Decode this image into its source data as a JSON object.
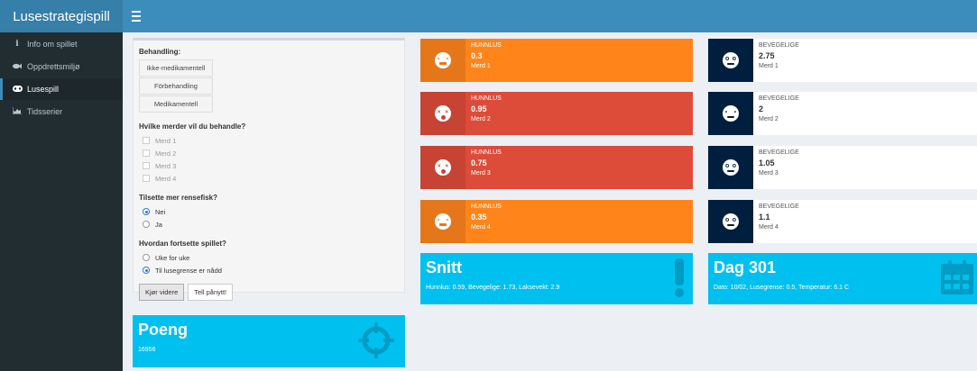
{
  "app": {
    "title": "Lusestrategispill"
  },
  "sidebar": {
    "items": [
      {
        "label": "Info om spillet",
        "icon": "info-icon",
        "active": false
      },
      {
        "label": "Oppdrettsmiljø",
        "icon": "fish-icon",
        "active": false
      },
      {
        "label": "Lusespill",
        "icon": "gamepad-icon",
        "active": true
      },
      {
        "label": "Tidsserier",
        "icon": "area-chart-icon",
        "active": false
      }
    ]
  },
  "controls": {
    "treatment_heading": "Behandling:",
    "treatment_options": [
      "Ikke-medikamentell",
      "Förbehandling",
      "Medikamentell"
    ],
    "pens_heading": "Hvilke merder vil du behandle?",
    "pens": [
      "Merd 1",
      "Merd 2",
      "Merd 3",
      "Merd 4"
    ],
    "cleaner_heading": "Tilsette mer rensefisk?",
    "cleaner_options": [
      {
        "label": "Nei",
        "selected": true
      },
      {
        "label": "Ja",
        "selected": false
      }
    ],
    "continue_heading": "Hvordan fortsette spillet?",
    "continue_options": [
      {
        "label": "Uke for uke",
        "selected": false
      },
      {
        "label": "Til lusegrense er nådd",
        "selected": true
      }
    ],
    "run_button": "Kjør videre",
    "restart_button": "Tell pånytt!"
  },
  "female_lice": [
    {
      "label": "HUNNLUS",
      "value": "0.3",
      "pen": "Merd 1",
      "status": "orange"
    },
    {
      "label": "HUNNLUS",
      "value": "0.95",
      "pen": "Merd 2",
      "status": "red"
    },
    {
      "label": "HUNNLUS",
      "value": "0.75",
      "pen": "Merd 3",
      "status": "red"
    },
    {
      "label": "HUNNLUS",
      "value": "0.35",
      "pen": "Merd 4",
      "status": "orange"
    }
  ],
  "mobile_lice": [
    {
      "label": "BEVEGELIGE",
      "value": "2.75",
      "pen": "Merd 1"
    },
    {
      "label": "BEVEGELIGE",
      "value": "2",
      "pen": "Merd 2"
    },
    {
      "label": "BEVEGELIGE",
      "value": "1.05",
      "pen": "Merd 3"
    },
    {
      "label": "BEVEGELIGE",
      "value": "1.1",
      "pen": "Merd 4"
    }
  ],
  "average": {
    "title": "Snitt",
    "text": "Hunnlus: 0.59, Bevegelige: 1.73, Laksevekt: 2.9"
  },
  "day": {
    "title": "Dag 301",
    "text": "Dato: 10/02, Lusegrense: 0.5, Temperatur: 6.1 C"
  },
  "score": {
    "title": "Poeng",
    "value": "16956"
  },
  "colors": {
    "orange": "#ff851b",
    "red": "#dd4b39",
    "aqua": "#00c0ef",
    "navy": "#001f3f",
    "header": "#3c8dbc"
  }
}
